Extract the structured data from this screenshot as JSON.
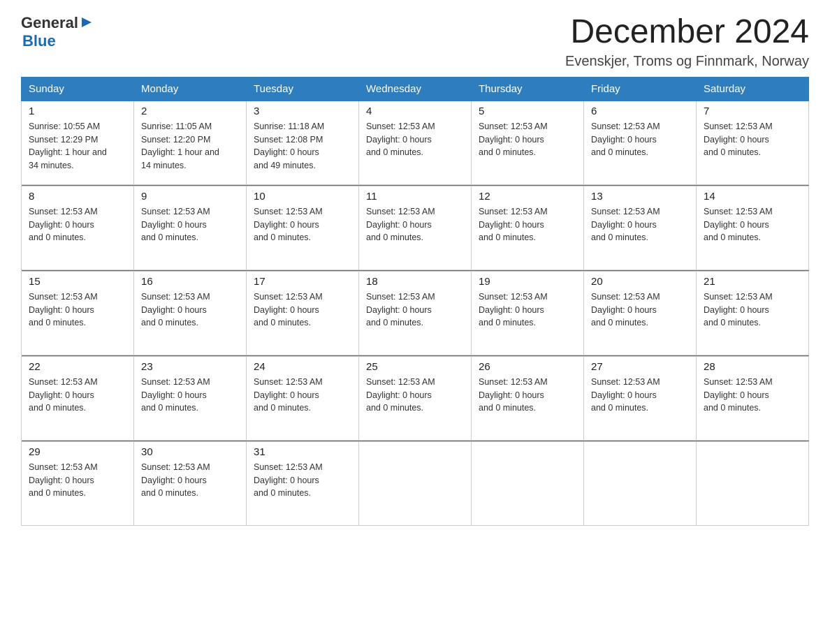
{
  "logo": {
    "general": "General",
    "blue": "Blue"
  },
  "title": "December 2024",
  "subtitle": "Evenskjer, Troms og Finnmark, Norway",
  "weekdays": [
    "Sunday",
    "Monday",
    "Tuesday",
    "Wednesday",
    "Thursday",
    "Friday",
    "Saturday"
  ],
  "weeks": [
    [
      {
        "day": "1",
        "info": "Sunrise: 10:55 AM\nSunset: 12:29 PM\nDaylight: 1 hour and\n34 minutes."
      },
      {
        "day": "2",
        "info": "Sunrise: 11:05 AM\nSunset: 12:20 PM\nDaylight: 1 hour and\n14 minutes."
      },
      {
        "day": "3",
        "info": "Sunrise: 11:18 AM\nSunset: 12:08 PM\nDaylight: 0 hours\nand 49 minutes."
      },
      {
        "day": "4",
        "info": "Sunset: 12:53 AM\nDaylight: 0 hours\nand 0 minutes."
      },
      {
        "day": "5",
        "info": "Sunset: 12:53 AM\nDaylight: 0 hours\nand 0 minutes."
      },
      {
        "day": "6",
        "info": "Sunset: 12:53 AM\nDaylight: 0 hours\nand 0 minutes."
      },
      {
        "day": "7",
        "info": "Sunset: 12:53 AM\nDaylight: 0 hours\nand 0 minutes."
      }
    ],
    [
      {
        "day": "8",
        "info": "Sunset: 12:53 AM\nDaylight: 0 hours\nand 0 minutes."
      },
      {
        "day": "9",
        "info": "Sunset: 12:53 AM\nDaylight: 0 hours\nand 0 minutes."
      },
      {
        "day": "10",
        "info": "Sunset: 12:53 AM\nDaylight: 0 hours\nand 0 minutes."
      },
      {
        "day": "11",
        "info": "Sunset: 12:53 AM\nDaylight: 0 hours\nand 0 minutes."
      },
      {
        "day": "12",
        "info": "Sunset: 12:53 AM\nDaylight: 0 hours\nand 0 minutes."
      },
      {
        "day": "13",
        "info": "Sunset: 12:53 AM\nDaylight: 0 hours\nand 0 minutes."
      },
      {
        "day": "14",
        "info": "Sunset: 12:53 AM\nDaylight: 0 hours\nand 0 minutes."
      }
    ],
    [
      {
        "day": "15",
        "info": "Sunset: 12:53 AM\nDaylight: 0 hours\nand 0 minutes."
      },
      {
        "day": "16",
        "info": "Sunset: 12:53 AM\nDaylight: 0 hours\nand 0 minutes."
      },
      {
        "day": "17",
        "info": "Sunset: 12:53 AM\nDaylight: 0 hours\nand 0 minutes."
      },
      {
        "day": "18",
        "info": "Sunset: 12:53 AM\nDaylight: 0 hours\nand 0 minutes."
      },
      {
        "day": "19",
        "info": "Sunset: 12:53 AM\nDaylight: 0 hours\nand 0 minutes."
      },
      {
        "day": "20",
        "info": "Sunset: 12:53 AM\nDaylight: 0 hours\nand 0 minutes."
      },
      {
        "day": "21",
        "info": "Sunset: 12:53 AM\nDaylight: 0 hours\nand 0 minutes."
      }
    ],
    [
      {
        "day": "22",
        "info": "Sunset: 12:53 AM\nDaylight: 0 hours\nand 0 minutes."
      },
      {
        "day": "23",
        "info": "Sunset: 12:53 AM\nDaylight: 0 hours\nand 0 minutes."
      },
      {
        "day": "24",
        "info": "Sunset: 12:53 AM\nDaylight: 0 hours\nand 0 minutes."
      },
      {
        "day": "25",
        "info": "Sunset: 12:53 AM\nDaylight: 0 hours\nand 0 minutes."
      },
      {
        "day": "26",
        "info": "Sunset: 12:53 AM\nDaylight: 0 hours\nand 0 minutes."
      },
      {
        "day": "27",
        "info": "Sunset: 12:53 AM\nDaylight: 0 hours\nand 0 minutes."
      },
      {
        "day": "28",
        "info": "Sunset: 12:53 AM\nDaylight: 0 hours\nand 0 minutes."
      }
    ],
    [
      {
        "day": "29",
        "info": "Sunset: 12:53 AM\nDaylight: 0 hours\nand 0 minutes."
      },
      {
        "day": "30",
        "info": "Sunset: 12:53 AM\nDaylight: 0 hours\nand 0 minutes."
      },
      {
        "day": "31",
        "info": "Sunset: 12:53 AM\nDaylight: 0 hours\nand 0 minutes."
      },
      {
        "day": "",
        "info": ""
      },
      {
        "day": "",
        "info": ""
      },
      {
        "day": "",
        "info": ""
      },
      {
        "day": "",
        "info": ""
      }
    ]
  ],
  "colors": {
    "header_bg": "#2e7dbf",
    "divider": "#2e7dbf",
    "border": "#ccc"
  }
}
